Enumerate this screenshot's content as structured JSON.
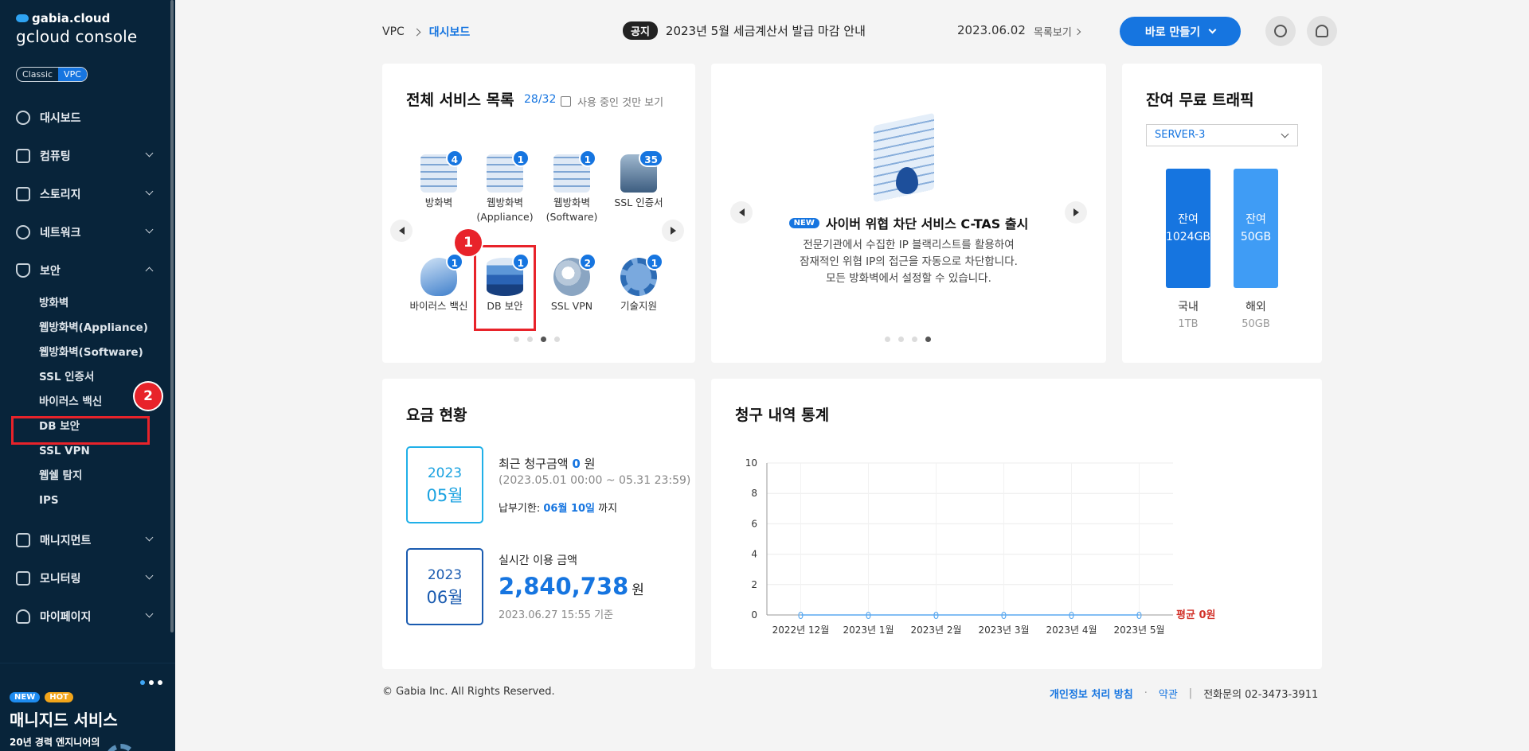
{
  "sidebar": {
    "brand_small": "gabia.cloud",
    "brand_big": "gcloud console",
    "mode": [
      "Classic",
      "VPC"
    ],
    "items": [
      {
        "label": "대시보드"
      },
      {
        "label": "컴퓨팅"
      },
      {
        "label": "스토리지"
      },
      {
        "label": "네트워크"
      },
      {
        "label": "보안"
      },
      {
        "label": "매니지먼트"
      },
      {
        "label": "모니터링"
      },
      {
        "label": "마이페이지"
      }
    ],
    "security_sub": [
      "방화벽",
      "웹방화벽(Appliance)",
      "웹방화벽(Software)",
      "SSL 인증서",
      "바이러스 백신",
      "DB 보안",
      "SSL VPN",
      "웹쉘 탐지",
      "IPS"
    ],
    "step1": "1",
    "step2": "2",
    "promo": {
      "tag_new": "NEW",
      "tag_hot": "HOT",
      "title": "매니지드 서비스",
      "desc": "20년 경력 엔지니어의"
    }
  },
  "topbar": {
    "crumb_root": "VPC",
    "crumb_current": "대시보드",
    "notice_pill": "공지",
    "notice_text": "2023년 5월 세금계산서 발급 마감 안내",
    "notice_date": "2023.06.02",
    "list_link": "목록보기",
    "make_button": "바로 만들기"
  },
  "services": {
    "title": "전체 서비스 목록",
    "count": "28/32",
    "filter_label": "사용 중인 것만 보기",
    "items": [
      {
        "label": "방화벽",
        "badge": "4"
      },
      {
        "label": "웹방화벽\n(Appliance)",
        "badge": "1"
      },
      {
        "label": "웹방화벽\n(Software)",
        "badge": "1"
      },
      {
        "label": "SSL 인증서",
        "badge": "35"
      },
      {
        "label": "바이러스 백신",
        "badge": "1"
      },
      {
        "label": "DB 보안",
        "badge": "1"
      },
      {
        "label": "SSL VPN",
        "badge": "2"
      },
      {
        "label": "기술지원",
        "badge": "1"
      }
    ]
  },
  "banner": {
    "new_tag": "NEW",
    "title": "사이버 위협 차단 서비스 C-TAS 출시",
    "line1": "전문기관에서 수집한 IP 블랙리스트를 활용하여",
    "line2": "잠재적인 위협 IP의 접근을 자동으로 차단합니다.",
    "line3": "모든 방화벽에서 설정할 수 있습니다."
  },
  "traffic": {
    "title": "잔여 무료 트래픽",
    "server_select": "SERVER-3",
    "bars": [
      {
        "top": "잔여",
        "value": "1024GB",
        "label": "국내",
        "total": "1TB",
        "color": "#1675e0",
        "level": 1.0
      },
      {
        "top": "잔여",
        "value": "50GB",
        "label": "해외",
        "total": "50GB",
        "color": "#3f9cf5",
        "level": 1.0
      }
    ]
  },
  "charges": {
    "title": "요금 현황",
    "recent_year": "2023",
    "recent_month": "05월",
    "recent_label": "최근 청구금액",
    "recent_amount": "0",
    "won": "원",
    "recent_period": "(2023.05.01 00:00 ~ 05.31 23:59)",
    "due_label": "납부기한:",
    "due_date": "06월 10일",
    "due_suffix": "까지",
    "realtime_year": "2023",
    "realtime_month": "06월",
    "realtime_label": "실시간 이용 금액",
    "realtime_amount": "2,840,738",
    "realtime_basis": "2023.06.27 15:55 기준"
  },
  "billing": {
    "title": "청구 내역 통계"
  },
  "chart_data": {
    "type": "line",
    "categories": [
      "2022년 12월",
      "2023년 1월",
      "2023년 2월",
      "2023년 3월",
      "2023년 4월",
      "2023년 5월"
    ],
    "values": [
      0,
      0,
      0,
      0,
      0,
      0
    ],
    "yticks": [
      0,
      2,
      4,
      6,
      8,
      10
    ],
    "ylim": [
      0,
      10
    ],
    "average_label": "평균 0원",
    "grid": true
  },
  "footer": {
    "copyright": "© Gabia Inc. All Rights Reserved.",
    "privacy": "개인정보 처리 방침",
    "terms": "약관",
    "divider": "|",
    "contact": "전화문의  02-3473-3911"
  }
}
